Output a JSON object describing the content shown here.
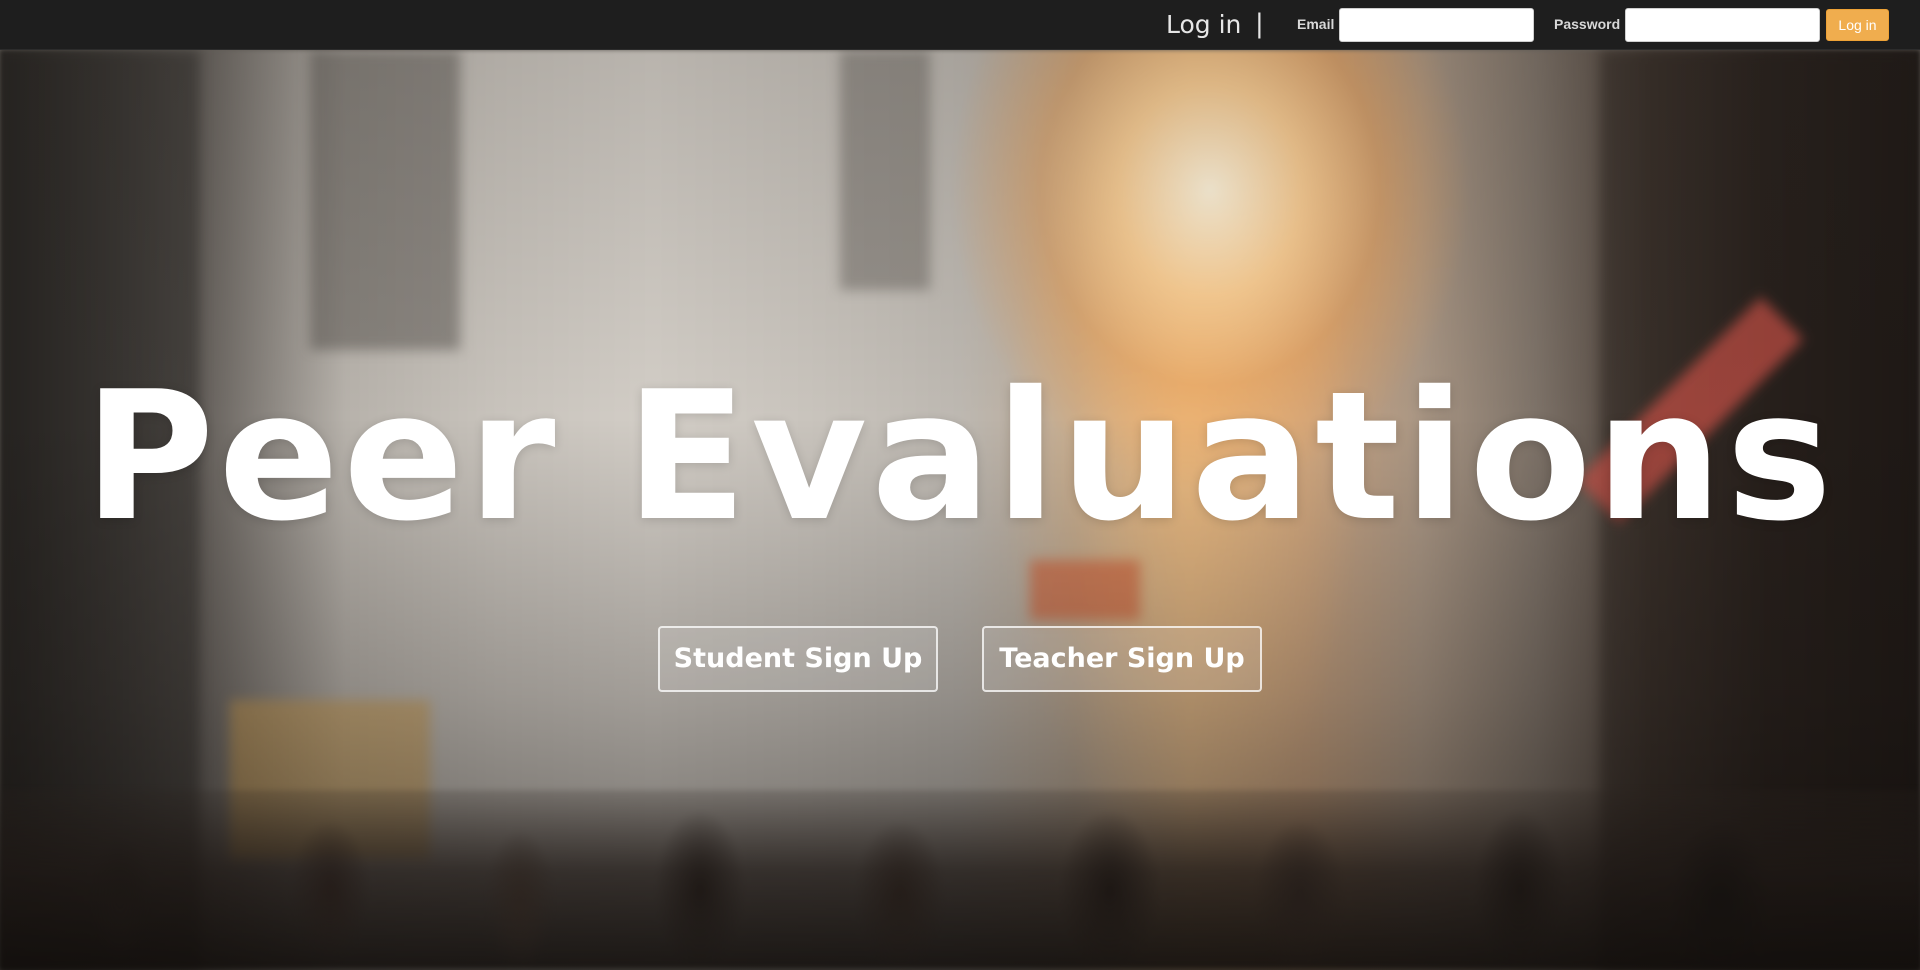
{
  "navbar": {
    "title": "Log in",
    "separator": "|",
    "email_label": "Email",
    "email_value": "",
    "password_label": "Password",
    "password_value": "",
    "login_button": "Log in"
  },
  "hero": {
    "title": "Peer Evaluations",
    "student_signup": "Student Sign Up",
    "teacher_signup": "Teacher Sign Up"
  },
  "colors": {
    "navbar_bg": "#1e1e1e",
    "login_button": "#f0ad4e",
    "hero_text": "#ffffff"
  }
}
